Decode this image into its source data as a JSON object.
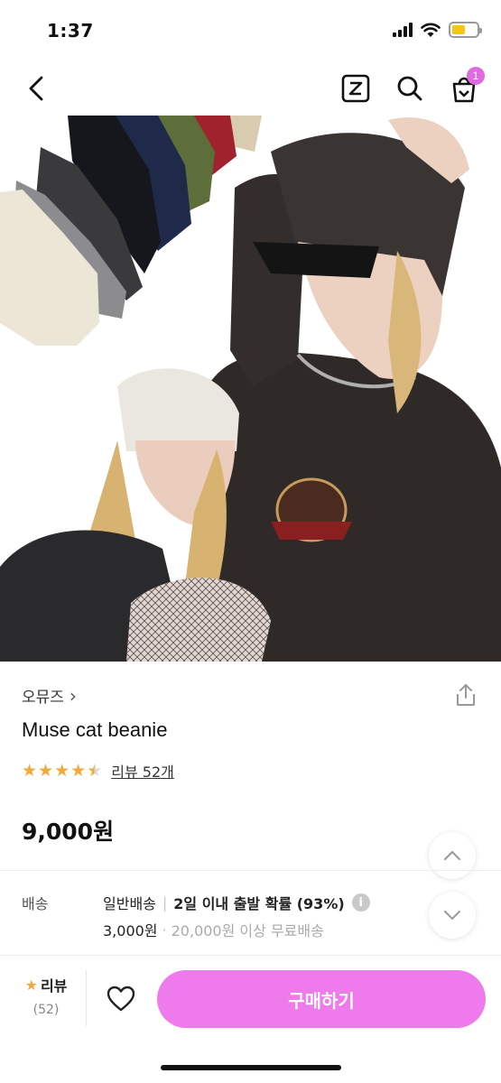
{
  "status_bar": {
    "time": "1:37",
    "battery_level": 0.55
  },
  "nav": {
    "back_icon": "chevron-left-icon",
    "zigzag_icon": "z-logo-icon",
    "search_icon": "search-icon",
    "cart_icon": "shopping-bag-icon",
    "cart_badge": "1",
    "badge_color": "#e06be0"
  },
  "product": {
    "brand": "오뮤즈",
    "brand_chevron": "›",
    "title": "Muse cat beanie",
    "rating": 4.5,
    "review_link": "리뷰 52개",
    "price": "9,000원",
    "star_color": "#f2a93b"
  },
  "shipping": {
    "label": "배송",
    "type": "일반배송",
    "separator": "|",
    "probability": "2일 이내 출발 확률 (93%)",
    "info_icon": "i",
    "fee": "3,000원",
    "dot": "·",
    "free_condition": "20,000원 이상 무료배송"
  },
  "bottom_bar": {
    "review_label": "리뷰",
    "review_count": "(52)",
    "heart_icon": "heart-icon",
    "buy_label": "구매하기",
    "buy_color": "#ef7aeb"
  }
}
